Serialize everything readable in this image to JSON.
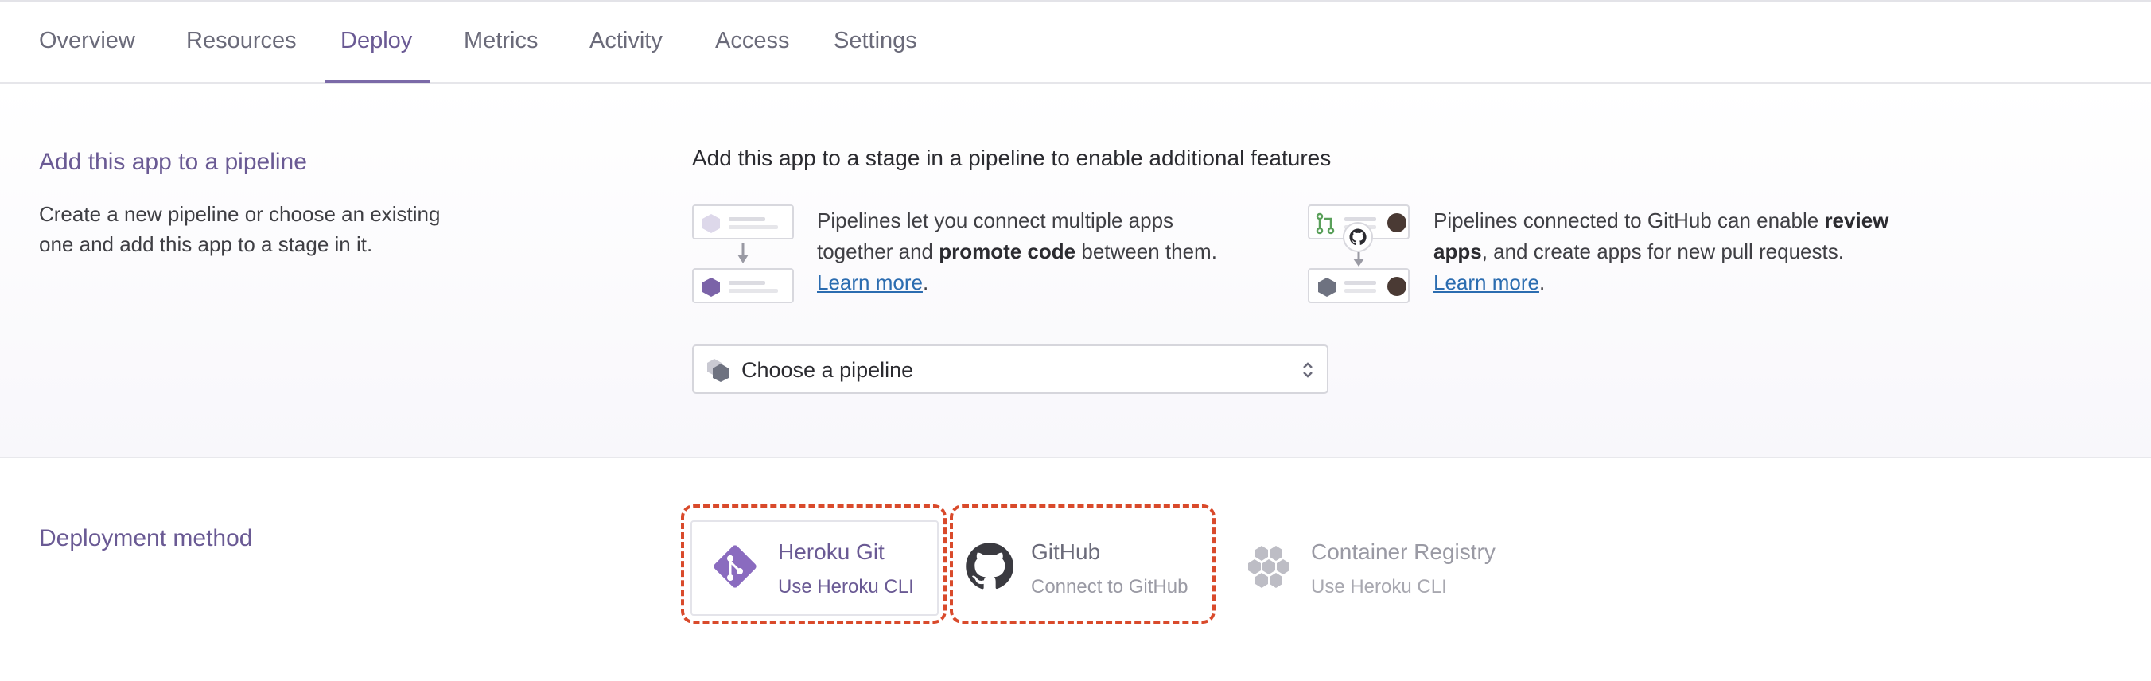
{
  "tabs": [
    {
      "label": "Overview"
    },
    {
      "label": "Resources"
    },
    {
      "label": "Deploy"
    },
    {
      "label": "Metrics"
    },
    {
      "label": "Activity"
    },
    {
      "label": "Access"
    },
    {
      "label": "Settings"
    }
  ],
  "pipeline": {
    "title": "Add this app to a pipeline",
    "desc_line1": "Create a new pipeline or choose an existing",
    "desc_line2": "one and add this app to a stage in it.",
    "headline": "Add this app to a stage in a pipeline to enable additional features",
    "feature1": {
      "line1": "Pipelines let you connect multiple apps",
      "line2_pre": "together and ",
      "line2_bold": "promote code",
      "line2_post": " between them.",
      "link": "Learn more",
      "link_suffix": "."
    },
    "feature2": {
      "line1_pre": "Pipelines connected to GitHub can enable ",
      "line1_bold": "review",
      "line2_bold": "apps",
      "line2_post": ", and create apps for new pull requests.",
      "link": "Learn more",
      "link_suffix": "."
    },
    "select_placeholder": "Choose a pipeline"
  },
  "deploy": {
    "title": "Deployment method",
    "methods": [
      {
        "name": "Heroku Git",
        "sub": "Use Heroku CLI",
        "icon": "heroku-git-icon"
      },
      {
        "name": "GitHub",
        "sub": "Connect to GitHub",
        "icon": "github-icon"
      },
      {
        "name": "Container Registry",
        "sub": "Use Heroku CLI",
        "icon": "container-registry-icon"
      }
    ]
  },
  "colors": {
    "accent": "#6a5a94",
    "link": "#2b6cb0",
    "highlight": "#d94a2b"
  }
}
